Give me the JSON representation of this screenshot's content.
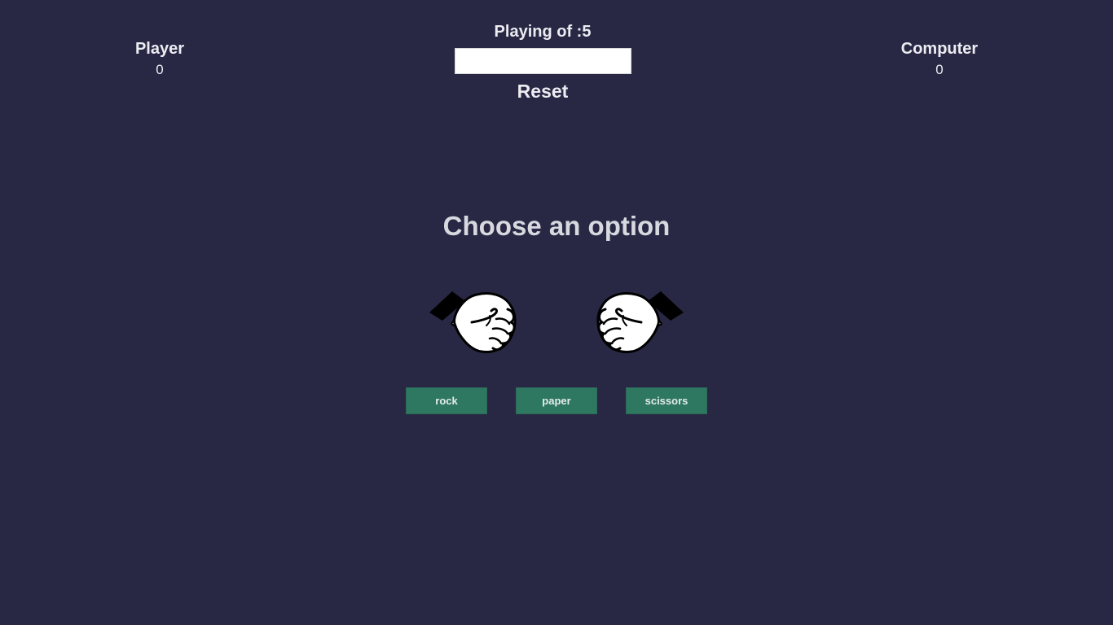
{
  "player": {
    "label": "Player",
    "score": "0"
  },
  "computer": {
    "label": "Computer",
    "score": "0"
  },
  "rounds": {
    "label": "Playing of :5",
    "input_value": "",
    "input_placeholder": ""
  },
  "reset_label": "Reset",
  "headline": "Choose an option",
  "hands": {
    "left_icon": "fist-left-icon",
    "right_icon": "fist-right-icon"
  },
  "options": [
    {
      "label": "rock"
    },
    {
      "label": "paper"
    },
    {
      "label": "scissors"
    }
  ],
  "colors": {
    "background": "#282844",
    "button": "#2e7862",
    "text": "#ececf2"
  }
}
